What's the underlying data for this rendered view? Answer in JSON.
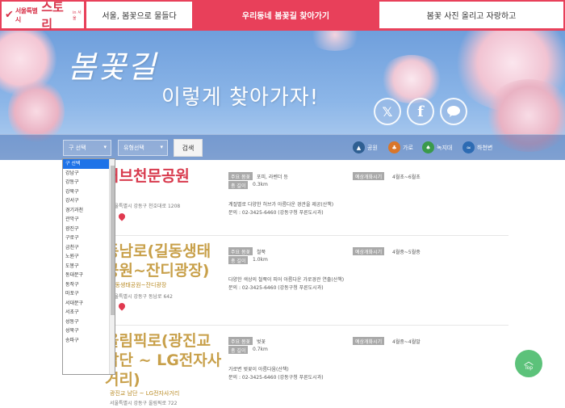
{
  "header": {
    "logo": {
      "small": "서울특별시",
      "big": "스토리",
      "tiny": "in 서울"
    },
    "tabs": [
      {
        "label": "서울, 봄꽃으로 물들다"
      },
      {
        "label": "우리동네 봄꽃길 찾아가기"
      },
      {
        "label": "봄꽃 사진 올리고 자랑하고"
      }
    ]
  },
  "hero": {
    "title": "봄꽃길",
    "subtitle": "이렇게 찾아가자!",
    "social": [
      "twitter-icon",
      "facebook-icon",
      "kakao-icon"
    ]
  },
  "filters": {
    "district_select": "구 선택",
    "type_select": "유형선택",
    "search_label": "검색",
    "legend": [
      {
        "label": "공원",
        "color": "#3b6ea5",
        "icon": "park-icon"
      },
      {
        "label": "가로",
        "color": "#e07a24",
        "icon": "street-icon"
      },
      {
        "label": "녹지대",
        "color": "#3a9a4a",
        "icon": "greenbelt-icon"
      },
      {
        "label": "하천변",
        "color": "#2f6fb8",
        "icon": "riverside-icon"
      }
    ]
  },
  "dropdown": {
    "items": [
      "구 선택",
      "강남구",
      "강동구",
      "강북구",
      "강서구",
      "경기과천",
      "관악구",
      "광진구",
      "구로구",
      "금천구",
      "노원구",
      "도봉구",
      "동대문구",
      "동작구",
      "마포구",
      "서대문구",
      "서초구",
      "성동구",
      "성북구",
      "송파구"
    ]
  },
  "entries": [
    {
      "title_lines": [
        "허브천문공원"
      ],
      "subtitle": "",
      "address": "서울특별시 강동구 천호대로 1208",
      "flower_label": "주요 봄꽃",
      "flower": "포피, 라벤더 등",
      "length_label": "총 길이",
      "length": "0.3km",
      "period_label": "예상개화시기",
      "period": "4월초~6월초",
      "description": "계절별로 다양한 허브가 아름다운 경관을 제공(산책)",
      "contact": "문의 : 02-3425-6460 (강동구청 푸른도시과)"
    },
    {
      "title_lines": [
        "동남로(길동생태",
        "공원~잔디광장)"
      ],
      "subtitle": "길동생태공원~잔디광장",
      "address": "서울특별시 강동구 동남로 642",
      "flower_label": "주요 봄꽃",
      "flower": "철쭉",
      "length_label": "총 길이",
      "length": "1.0km",
      "period_label": "예상개화시기",
      "period": "4월중~5월중",
      "description": "다양한 색상의 철쭉이 피어 아름다운 가로경관 연출(산책)",
      "contact": "문의 : 02-3425-6460 (강동구청 푸른도시과)"
    },
    {
      "title_lines": [
        "올림픽로(광진교",
        "남단 ~ LG전자사",
        "거리)"
      ],
      "subtitle": "광진교 남단 ~ LG전자사거리",
      "address": "서울특별시 강동구 올림픽로 722",
      "flower_label": "주요 봄꽃",
      "flower": "벚꽃",
      "length_label": "총 길이",
      "length": "0.7km",
      "period_label": "예상개화시기",
      "period": "4월중~4월말",
      "description": "가로변 벚꽃이 아름다움(산책)",
      "contact": "문의 : 02-3425-6460 (강동구청 푸른도시과)"
    }
  ],
  "top_button": "Top"
}
